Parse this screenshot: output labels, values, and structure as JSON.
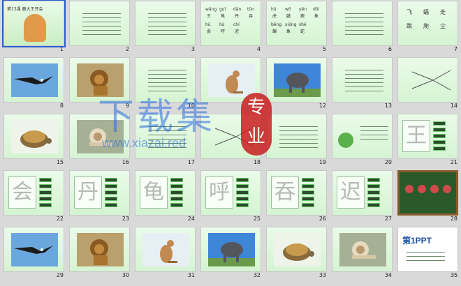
{
  "slides": [
    {
      "num": "1",
      "kind": "title",
      "title": "第13课 鹿大王开会"
    },
    {
      "num": "2",
      "kind": "text"
    },
    {
      "num": "3",
      "kind": "text"
    },
    {
      "num": "4",
      "kind": "pinyin",
      "pinyin": [
        "wāng",
        "guī",
        "dān",
        "tūn",
        "hū",
        "hú",
        "chí"
      ],
      "hanzi": [
        "王",
        "龟",
        "丹",
        "吞",
        "会",
        "呼",
        "迟"
      ]
    },
    {
      "num": "5",
      "kind": "pinyin",
      "pinyin": [
        "hǔ",
        "wō",
        "yēn",
        "dōi",
        "bēng",
        "xióng",
        "shé"
      ],
      "hanzi": [
        "虎",
        "鼬",
        "鹿",
        "象",
        "蝙",
        "象",
        "蛇"
      ]
    },
    {
      "num": "6",
      "kind": "text"
    },
    {
      "num": "7",
      "kind": "hanzi",
      "hanzi": [
        "飞",
        "蝠",
        "走",
        "跳",
        "爬",
        "尘"
      ]
    },
    {
      "num": "8",
      "kind": "photo",
      "animal": "eagle"
    },
    {
      "num": "9",
      "kind": "photo",
      "animal": "lion"
    },
    {
      "num": "10",
      "kind": "text"
    },
    {
      "num": "11",
      "kind": "photo",
      "animal": "kangaroo"
    },
    {
      "num": "12",
      "kind": "photo",
      "animal": "elephant"
    },
    {
      "num": "13",
      "kind": "text"
    },
    {
      "num": "14",
      "kind": "diagram"
    },
    {
      "num": "15",
      "kind": "photo",
      "animal": "tortoise"
    },
    {
      "num": "16",
      "kind": "photo",
      "animal": "snail"
    },
    {
      "num": "17",
      "kind": "text"
    },
    {
      "num": "18",
      "kind": "diagram"
    },
    {
      "num": "19",
      "kind": "text"
    },
    {
      "num": "20",
      "kind": "cartoon"
    },
    {
      "num": "21",
      "kind": "char",
      "char": "王"
    },
    {
      "num": "22",
      "kind": "char",
      "char": "会"
    },
    {
      "num": "23",
      "kind": "char",
      "char": "丹"
    },
    {
      "num": "24",
      "kind": "char",
      "char": "龟"
    },
    {
      "num": "25",
      "kind": "char",
      "char": "呼"
    },
    {
      "num": "26",
      "kind": "char",
      "char": "吞"
    },
    {
      "num": "27",
      "kind": "char",
      "char": "迟"
    },
    {
      "num": "28",
      "kind": "board"
    },
    {
      "num": "29",
      "kind": "photo",
      "animal": "eagle"
    },
    {
      "num": "30",
      "kind": "photo",
      "animal": "lion"
    },
    {
      "num": "31",
      "kind": "photo",
      "animal": "kangaroo"
    },
    {
      "num": "32",
      "kind": "photo",
      "animal": "elephant"
    },
    {
      "num": "33",
      "kind": "photo",
      "animal": "tortoise"
    },
    {
      "num": "34",
      "kind": "photo",
      "animal": "snail"
    },
    {
      "num": "35",
      "kind": "ppt",
      "brand": "第1PPT"
    }
  ],
  "watermark": {
    "cn": "下载集",
    "pro": "专业",
    "url": "www.xiazai.red"
  },
  "colors": {
    "accent": "#2b5fd0",
    "slide_bg": "#d5f4d2",
    "board": "#2a5a2a"
  }
}
